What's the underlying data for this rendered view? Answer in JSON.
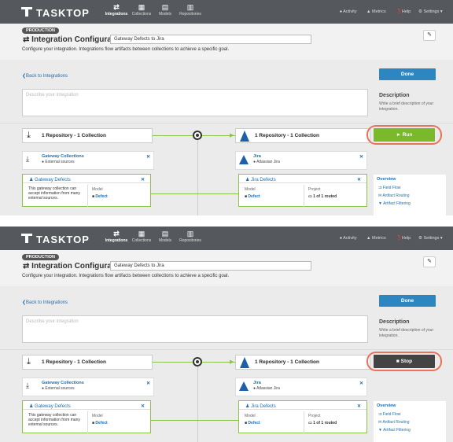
{
  "nav": {
    "logo_text": "TASKTOP",
    "tabs": [
      {
        "label": "Integrations",
        "icon": "⇄"
      },
      {
        "label": "Collections",
        "icon": "▦"
      },
      {
        "label": "Models",
        "icon": "▤"
      },
      {
        "label": "Repositories",
        "icon": "▥"
      }
    ],
    "activity": "Activity",
    "metrics": "Metrics",
    "help": "Help",
    "settings": "Settings"
  },
  "header": {
    "badge": "PRODUCTION",
    "title": "Integration Configuration",
    "name_value": "Gateway Defects to Jira",
    "subtitle": "Configure your integration. Integrations flow artifacts between collections to achieve a specific goal.",
    "pin": "✎"
  },
  "back_link": "Back to Integrations",
  "done_label": "Done",
  "description": {
    "placeholder": "Describe your integration",
    "heading": "Description",
    "help": "Write a brief description of your integration."
  },
  "left_repo": "1 Repository - 1 Collection",
  "right_repo": "1 Repository - 1 Collection",
  "gateway_card": {
    "title": "Gateway Collections",
    "subtitle": "External sources"
  },
  "gateway_defects": {
    "title": "Gateway Defects",
    "body": "This gateway collection can accept information from many external sources.",
    "model_label": "Model",
    "model_value": "Defect"
  },
  "jira_card": {
    "title": "Jira",
    "subtitle": "Atlassian Jira"
  },
  "jira_defects": {
    "title": "Jira Defects",
    "model_label": "Model",
    "model_value": "Defect",
    "project_label": "Project",
    "project_value": "1 of 1 routed"
  },
  "overview": {
    "heading": "Overview",
    "items": [
      "Field Flow",
      "Artifact Routing",
      "Artifact Filtering"
    ]
  },
  "panels": [
    {
      "action_label": "► Run",
      "action_state": "run"
    },
    {
      "action_label": "■ Stop",
      "action_state": "stop"
    }
  ],
  "colors": {
    "nav": "#55585c",
    "accent": "#2e86c1",
    "run": "#7ab929",
    "stop": "#444444",
    "highlight": "#e8725a"
  }
}
